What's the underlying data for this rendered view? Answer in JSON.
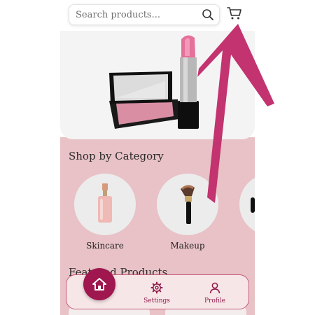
{
  "search": {
    "placeholder": "Search products..."
  },
  "header": {
    "cart_icon": "cart-icon",
    "search_icon": "search-icon"
  },
  "sections": {
    "categories_title": "Shop by Category",
    "featured_title": "Featured Products"
  },
  "categories": [
    {
      "label": "Skincare",
      "icon": "serum-bottle"
    },
    {
      "label": "Makeup",
      "icon": "makeup-brush"
    }
  ],
  "nav": {
    "home_icon": "home-icon",
    "settings_label": "Settings",
    "profile_label": "Profile"
  },
  "colors": {
    "accent": "#a0164e",
    "nav_text": "#8e1a48",
    "pink_bg": "#e8c2c6",
    "annotation": "#c2336f"
  }
}
